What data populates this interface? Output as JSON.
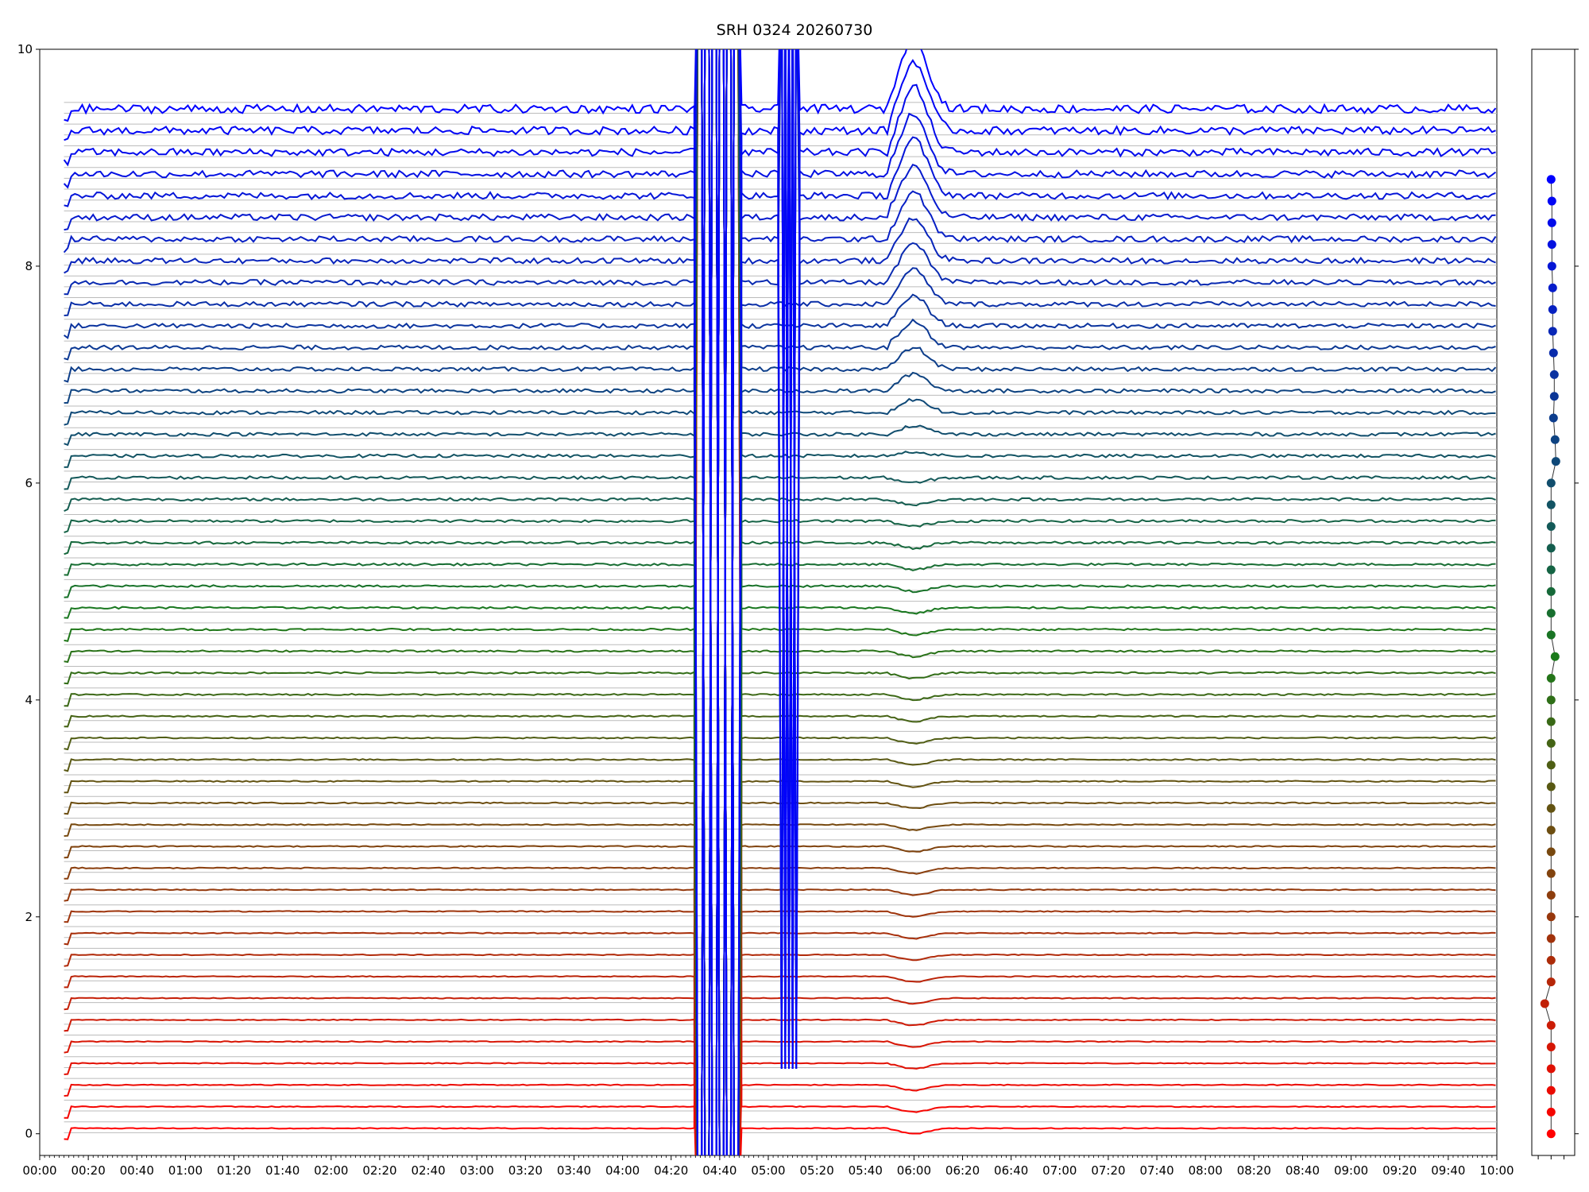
{
  "chart_data": [
    {
      "type": "line",
      "title": "SRH 0324 20260730",
      "xlabel": "",
      "ylabel": "",
      "xlim": [
        "00:00",
        "10:00"
      ],
      "ylim": [
        -0.2,
        10
      ],
      "grid": false,
      "legend": "none",
      "x_ticks": [
        "00:00",
        "00:20",
        "00:40",
        "01:00",
        "01:20",
        "01:40",
        "02:00",
        "02:20",
        "02:40",
        "03:00",
        "03:20",
        "03:40",
        "04:00",
        "04:20",
        "04:40",
        "05:00",
        "05:20",
        "05:40",
        "06:00",
        "06:20",
        "06:40",
        "07:00",
        "07:20",
        "07:40",
        "08:00",
        "08:20",
        "08:40",
        "09:00",
        "09:20",
        "09:40",
        "10:00"
      ],
      "y_ticks": [
        0,
        2,
        4,
        6,
        8,
        10
      ],
      "series_count": 48,
      "series_baselines": [
        0.0,
        0.2,
        0.4,
        0.6,
        0.8,
        1.0,
        1.2,
        1.4,
        1.6,
        1.8,
        2.0,
        2.2,
        2.4,
        2.6,
        2.8,
        3.0,
        3.2,
        3.4,
        3.6,
        3.8,
        4.0,
        4.2,
        4.4,
        4.6,
        4.8,
        5.0,
        5.2,
        5.4,
        5.6,
        5.8,
        6.0,
        6.2,
        6.4,
        6.6,
        6.8,
        7.0,
        7.2,
        7.4,
        7.6,
        7.8,
        8.0,
        8.2,
        8.4,
        8.6,
        8.8,
        9.0,
        9.2,
        9.4
      ],
      "color_scale": [
        "#ff0000",
        "#1a7a1a",
        "#0000ff"
      ],
      "events": [
        {
          "type": "spike_band",
          "x": [
            "04:30",
            "04:48"
          ],
          "note": "saturated red/green traces"
        },
        {
          "type": "spike_band",
          "x": [
            "05:05",
            "05:12"
          ],
          "note": "saturated blue traces"
        },
        {
          "type": "bump",
          "x": "05:55",
          "note": "enhancement in upper channels"
        }
      ]
    },
    {
      "type": "scatter",
      "title": "",
      "ylim": [
        -0.2,
        10
      ],
      "points_y": [
        0.0,
        0.2,
        0.4,
        0.6,
        0.8,
        1.0,
        1.2,
        1.4,
        1.6,
        1.8,
        2.0,
        2.2,
        2.4,
        2.6,
        2.8,
        3.0,
        3.2,
        3.4,
        3.6,
        3.8,
        4.0,
        4.2,
        4.4,
        4.6,
        4.8,
        5.0,
        5.2,
        5.4,
        5.6,
        5.8,
        6.0,
        6.2,
        6.4,
        6.6,
        6.8,
        7.0,
        7.2,
        7.4,
        7.6,
        7.8,
        8.0,
        8.2,
        8.4,
        8.6,
        8.8
      ],
      "points_x_offset": [
        0,
        0,
        0,
        0,
        0,
        0,
        -0.8,
        0,
        0,
        0,
        0,
        0,
        0,
        0,
        0,
        0,
        0,
        0,
        0,
        0,
        0,
        0,
        0.5,
        0,
        0,
        0,
        0,
        0,
        0,
        0,
        0,
        0.6,
        0.5,
        0.3,
        0.4,
        0.4,
        0.3,
        0.2,
        0.2,
        0.2,
        0.1,
        0.1,
        0.1,
        0.1,
        0
      ]
    }
  ]
}
